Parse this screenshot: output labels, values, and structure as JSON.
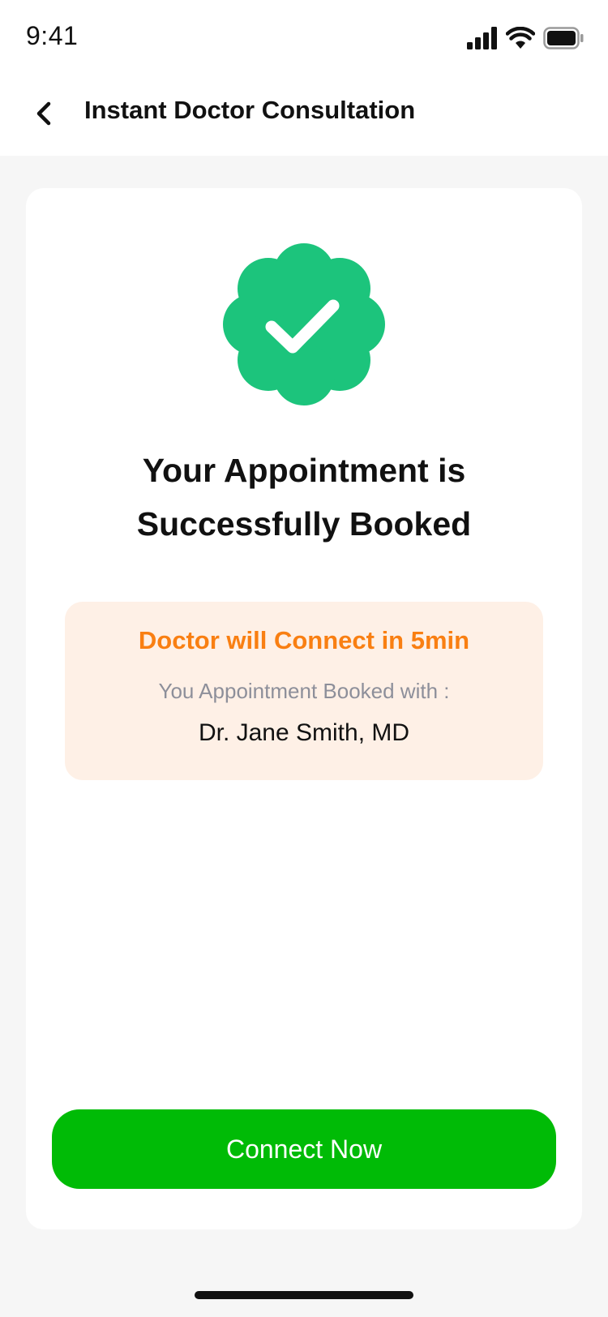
{
  "status_bar": {
    "time": "9:41",
    "icons": [
      "cellular-signal-icon",
      "wifi-icon",
      "battery-icon"
    ]
  },
  "nav": {
    "back_icon": "chevron-left-icon",
    "title": "Instant Doctor Consultation"
  },
  "confirmation": {
    "badge_icon": "verified-check-badge-icon",
    "headline_line1": "Your Appointment is",
    "headline_line2": "Successfully Booked"
  },
  "info": {
    "connect_text": "Doctor will Connect in 5min",
    "label": "You Appointment Booked with :",
    "doctor_name": "Dr. Jane Smith, MD"
  },
  "action": {
    "connect_label": "Connect Now"
  },
  "colors": {
    "accent_green": "#00bb06",
    "badge_green": "#1cc47c",
    "orange": "#f97f12",
    "info_bg": "#fef0e6"
  }
}
